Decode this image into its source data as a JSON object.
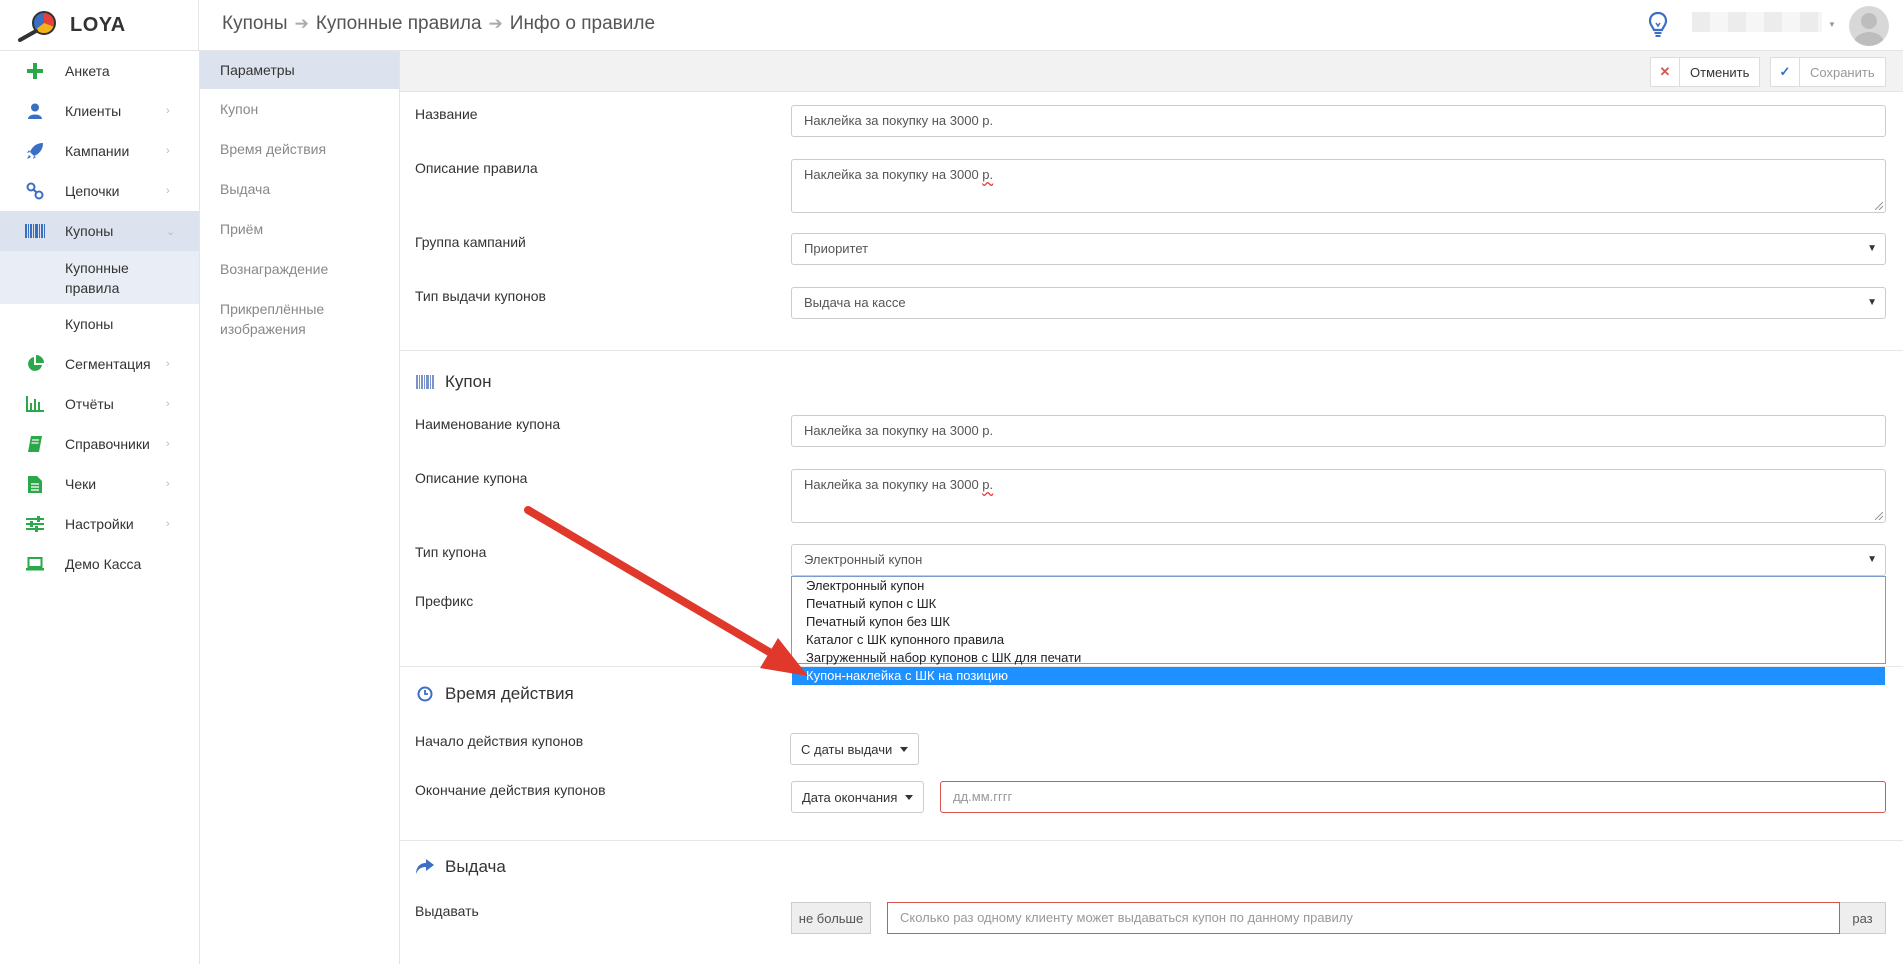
{
  "app": {
    "name": "LOYA"
  },
  "breadcrumb": [
    "Купоны",
    "Купонные правила",
    "Инфо о правиле"
  ],
  "sidebar": {
    "items": [
      {
        "label": "Анкета",
        "icon": "plus-icon"
      },
      {
        "label": "Клиенты",
        "icon": "user-icon"
      },
      {
        "label": "Кампании",
        "icon": "rocket-icon"
      },
      {
        "label": "Цепочки",
        "icon": "chain-icon"
      },
      {
        "label": "Купоны",
        "icon": "barcode-icon"
      },
      {
        "label": "Сегментация",
        "icon": "pie-chart-icon"
      },
      {
        "label": "Отчёты",
        "icon": "bar-chart-icon"
      },
      {
        "label": "Справочники",
        "icon": "book-icon"
      },
      {
        "label": "Чеки",
        "icon": "document-icon"
      },
      {
        "label": "Настройки",
        "icon": "sliders-icon"
      },
      {
        "label": "Демо Касса",
        "icon": "laptop-icon"
      }
    ],
    "subitems": [
      {
        "label": "Купонные правила"
      },
      {
        "label": "Купоны"
      }
    ]
  },
  "sections": [
    "Параметры",
    "Купон",
    "Время действия",
    "Выдача",
    "Приём",
    "Вознаграждение",
    "Прикреплённые изображения"
  ],
  "toolbar": {
    "cancel_label": "Отменить",
    "save_label": "Сохранить"
  },
  "form": {
    "name_label": "Название",
    "name_value": "Наклейка за покупку на 3000 р.",
    "desc_label": "Описание правила",
    "desc_value_main": "Наклейка за покупку на 3000 ",
    "desc_value_tail": "р.",
    "group_label": "Группа кампаний",
    "group_value": "Приоритет",
    "issue_type_label": "Тип выдачи купонов",
    "issue_type_value": "Выдача на кассе"
  },
  "coupon": {
    "title": "Купон",
    "name_label": "Наименование купона",
    "name_value": "Наклейка за покупку на 3000 р.",
    "desc_label": "Описание купона",
    "desc_value_main": "Наклейка за покупку на 3000 ",
    "desc_value_tail": "р.",
    "type_label": "Тип купона",
    "type_value": "Электронный купон",
    "prefix_label": "Префикс",
    "type_options": [
      "Электронный купон",
      "Печатный купон с ШК",
      "Печатный купон без ШК",
      "Каталог с ШК купонного правила",
      "Загруженный набор купонов с ШК для печати",
      "Купон-наклейка с ШК на позицию"
    ]
  },
  "validity": {
    "title": "Время действия",
    "start_label": "Начало действия купонов",
    "start_value": "С даты выдачи",
    "end_label": "Окончание действия купонов",
    "end_value": "Дата окончания",
    "end_placeholder": "дд.мм.гггг"
  },
  "issue": {
    "title": "Выдача",
    "label": "Выдавать",
    "prefix": "не больше",
    "placeholder": "Сколько раз одному клиенту может выдаваться купон по данному правилу",
    "suffix": "раз"
  },
  "colors": {
    "accent_green": "#2aa84a",
    "accent_blue": "#3a6fc4",
    "selection": "#1e90ff",
    "arrow": "#e0392b",
    "error": "#d9534f"
  }
}
